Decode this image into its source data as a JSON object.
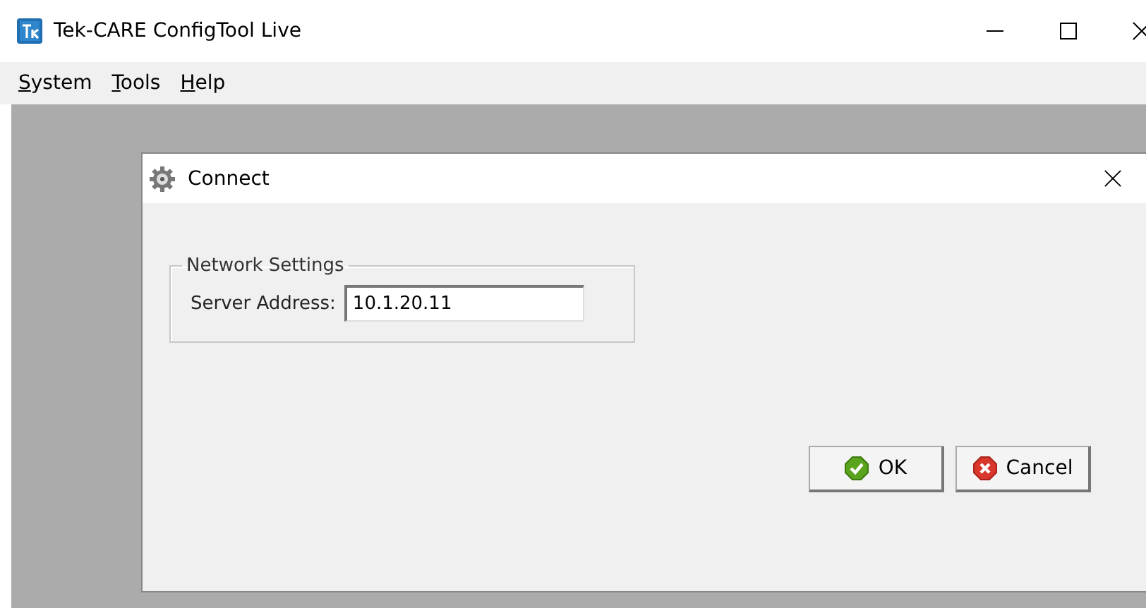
{
  "window": {
    "title": "Tek-CARE ConfigTool Live"
  },
  "menu": [
    {
      "label": "System"
    },
    {
      "label": "Tools"
    },
    {
      "label": "Help"
    }
  ],
  "dialog": {
    "title": "Connect",
    "group": {
      "title": "Network Settings",
      "field_label": "Server Address:",
      "value": "10.1.20.11"
    },
    "buttons": [
      {
        "kind": "ok",
        "label": "OK"
      },
      {
        "kind": "cancel",
        "label": "Cancel"
      }
    ]
  }
}
